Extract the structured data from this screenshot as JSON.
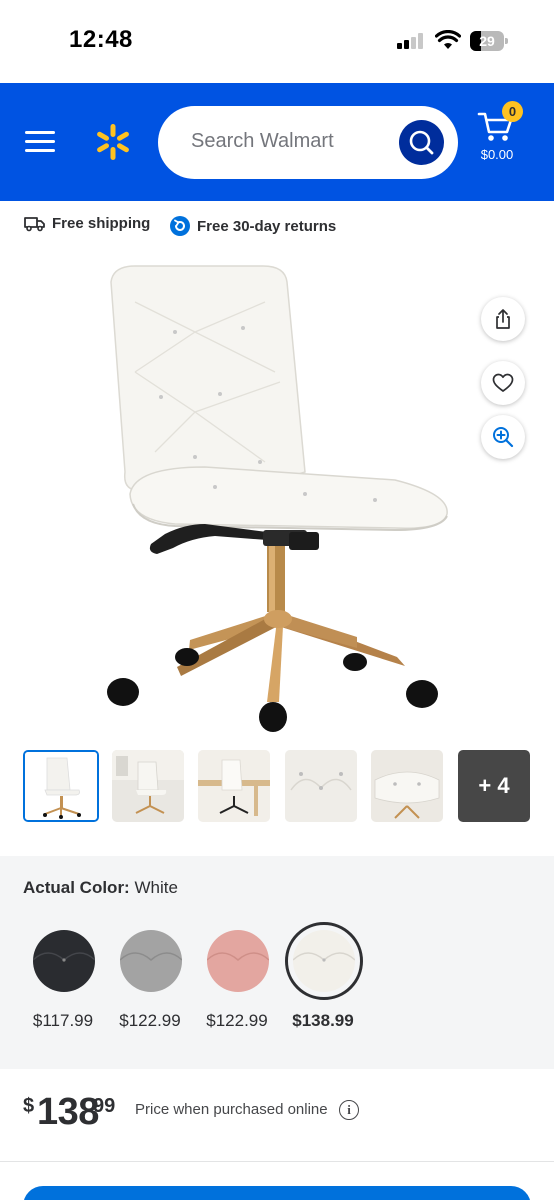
{
  "status_bar": {
    "time": "12:48",
    "battery": "29"
  },
  "header": {
    "menu_icon": "hamburger-menu-icon",
    "logo_icon": "walmart-spark-logo",
    "search_placeholder": "Search Walmart",
    "search_icon": "magnifier-icon",
    "cart_count": "0",
    "cart_total": "$0.00",
    "brand_color": "#0053e2",
    "accent_color": "#ffc220"
  },
  "perks": {
    "shipping": "Free shipping",
    "returns": "Free 30-day returns"
  },
  "product": {
    "actions": [
      "share-icon",
      "heart-icon",
      "zoom-in-icon"
    ],
    "thumbnails_more": "+ 4"
  },
  "variants": {
    "label": "Actual Color:",
    "selected_value": "White",
    "options": [
      {
        "color": "#2a2c30",
        "price": "$117.99"
      },
      {
        "color": "#a3a3a3",
        "price": "$122.99"
      },
      {
        "color": "#e3a6a0",
        "price": "$122.99"
      },
      {
        "color": "#f2f0ea",
        "price": "$138.99",
        "selected": true
      }
    ]
  },
  "price": {
    "currency": "$",
    "dollars": "138",
    "cents": "99",
    "note": "Price when purchased online",
    "info_icon": "i"
  }
}
